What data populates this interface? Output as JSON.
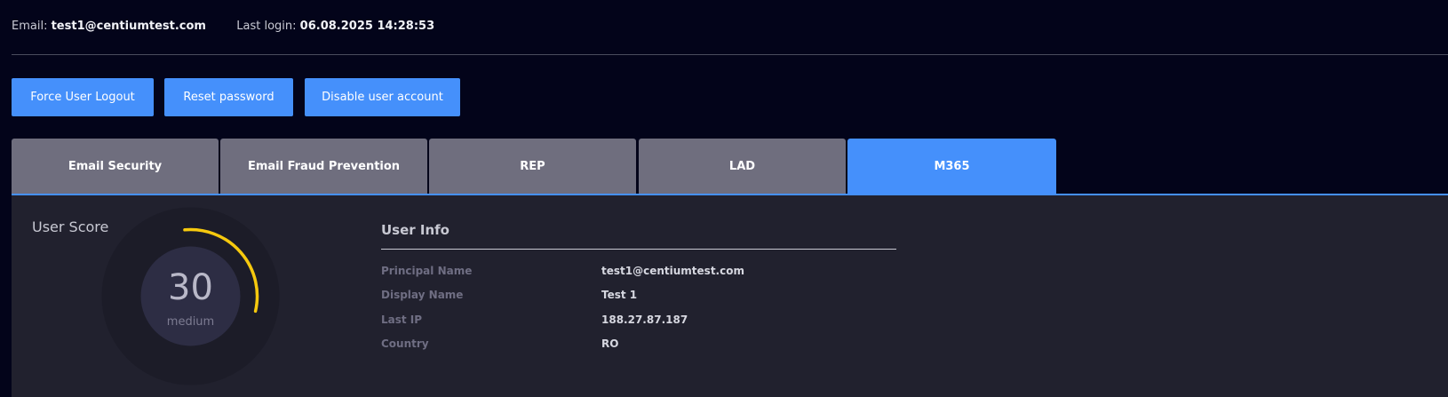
{
  "header": {
    "email_label": "Email:",
    "email_value": "test1@centiumtest.com",
    "last_login_label": "Last login:",
    "last_login_value": "06.08.2025  14:28:53"
  },
  "actions": {
    "force_logout": "Force User Logout",
    "reset_password": "Reset password",
    "disable_account": "Disable user account"
  },
  "tabs": [
    {
      "label": "Email Security",
      "active": false
    },
    {
      "label": "Email Fraud Prevention",
      "active": false
    },
    {
      "label": "REP",
      "active": false
    },
    {
      "label": "LAD",
      "active": false
    },
    {
      "label": "M365",
      "active": true
    }
  ],
  "user_score": {
    "title": "User Score",
    "value": "30",
    "level": "medium",
    "fraction": 0.3,
    "arc_color": "#f6c90e"
  },
  "user_info": {
    "title": "User Info",
    "rows": [
      {
        "label": "Principal Name",
        "value": "test1@centiumtest.com"
      },
      {
        "label": "Display Name",
        "value": "Test 1"
      },
      {
        "label": "Last IP",
        "value": "188.27.87.187"
      },
      {
        "label": "Country",
        "value": "RO"
      }
    ]
  },
  "colors": {
    "background": "#03041a",
    "accent": "#4590fb",
    "tab_inactive": "#6f6e7e",
    "panel": "#21212e"
  }
}
